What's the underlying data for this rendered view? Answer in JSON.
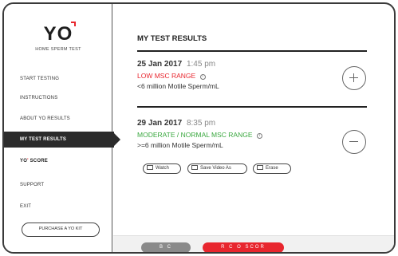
{
  "brand": {
    "logo_text": "YO",
    "tagline": "HOME SPERM TEST",
    "accent_color": "#e8262e"
  },
  "sidebar": {
    "items": [
      {
        "label": "START TESTING"
      },
      {
        "label": "INSTRUCTIONS"
      },
      {
        "label": "ABOUT YO RESULTS"
      },
      {
        "label": "MY TEST RESULTS"
      },
      {
        "label": "SCORE",
        "prefix": "YO"
      },
      {
        "label": "SUPPORT"
      },
      {
        "label": "EXIT"
      }
    ],
    "purchase_label": "PURCHASE A YO KIT"
  },
  "main": {
    "title": "MY TEST RESULTS",
    "results": [
      {
        "date": "25 Jan 2017",
        "time": "1:45 pm",
        "range": "LOW MSC RANGE",
        "description": "<6 million Motile Sperm/mL",
        "toggle_icon": "plus-icon"
      },
      {
        "date": "29 Jan 2017",
        "time": "8:35 pm",
        "range": "MODERATE / NORMAL MSC RANGE",
        "description": ">=6 million Motile Sperm/mL",
        "toggle_icon": "minus-icon"
      }
    ],
    "actions": {
      "watch": "Watch",
      "save": "Save Video As",
      "erase": "Erase"
    }
  },
  "bottom_bar": {
    "back_label": "B C",
    "yo_score_label": "R C O SCOR"
  },
  "colors": {
    "low": "#e8262e",
    "normal": "#3aa83f",
    "dark": "#2b2b2b"
  },
  "icons": {
    "info": "info-icon",
    "watch": "video-icon",
    "save": "save-icon",
    "erase": "trash-icon"
  }
}
